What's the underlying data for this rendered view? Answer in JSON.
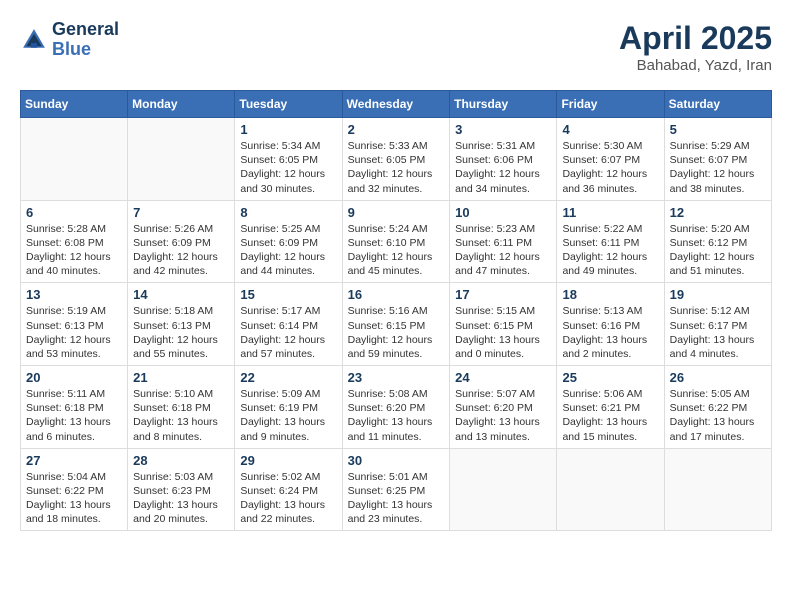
{
  "header": {
    "logo_line1": "General",
    "logo_line2": "Blue",
    "month": "April 2025",
    "location": "Bahabad, Yazd, Iran"
  },
  "weekdays": [
    "Sunday",
    "Monday",
    "Tuesday",
    "Wednesday",
    "Thursday",
    "Friday",
    "Saturday"
  ],
  "weeks": [
    [
      {
        "day": "",
        "info": ""
      },
      {
        "day": "",
        "info": ""
      },
      {
        "day": "1",
        "info": "Sunrise: 5:34 AM\nSunset: 6:05 PM\nDaylight: 12 hours and 30 minutes."
      },
      {
        "day": "2",
        "info": "Sunrise: 5:33 AM\nSunset: 6:05 PM\nDaylight: 12 hours and 32 minutes."
      },
      {
        "day": "3",
        "info": "Sunrise: 5:31 AM\nSunset: 6:06 PM\nDaylight: 12 hours and 34 minutes."
      },
      {
        "day": "4",
        "info": "Sunrise: 5:30 AM\nSunset: 6:07 PM\nDaylight: 12 hours and 36 minutes."
      },
      {
        "day": "5",
        "info": "Sunrise: 5:29 AM\nSunset: 6:07 PM\nDaylight: 12 hours and 38 minutes."
      }
    ],
    [
      {
        "day": "6",
        "info": "Sunrise: 5:28 AM\nSunset: 6:08 PM\nDaylight: 12 hours and 40 minutes."
      },
      {
        "day": "7",
        "info": "Sunrise: 5:26 AM\nSunset: 6:09 PM\nDaylight: 12 hours and 42 minutes."
      },
      {
        "day": "8",
        "info": "Sunrise: 5:25 AM\nSunset: 6:09 PM\nDaylight: 12 hours and 44 minutes."
      },
      {
        "day": "9",
        "info": "Sunrise: 5:24 AM\nSunset: 6:10 PM\nDaylight: 12 hours and 45 minutes."
      },
      {
        "day": "10",
        "info": "Sunrise: 5:23 AM\nSunset: 6:11 PM\nDaylight: 12 hours and 47 minutes."
      },
      {
        "day": "11",
        "info": "Sunrise: 5:22 AM\nSunset: 6:11 PM\nDaylight: 12 hours and 49 minutes."
      },
      {
        "day": "12",
        "info": "Sunrise: 5:20 AM\nSunset: 6:12 PM\nDaylight: 12 hours and 51 minutes."
      }
    ],
    [
      {
        "day": "13",
        "info": "Sunrise: 5:19 AM\nSunset: 6:13 PM\nDaylight: 12 hours and 53 minutes."
      },
      {
        "day": "14",
        "info": "Sunrise: 5:18 AM\nSunset: 6:13 PM\nDaylight: 12 hours and 55 minutes."
      },
      {
        "day": "15",
        "info": "Sunrise: 5:17 AM\nSunset: 6:14 PM\nDaylight: 12 hours and 57 minutes."
      },
      {
        "day": "16",
        "info": "Sunrise: 5:16 AM\nSunset: 6:15 PM\nDaylight: 12 hours and 59 minutes."
      },
      {
        "day": "17",
        "info": "Sunrise: 5:15 AM\nSunset: 6:15 PM\nDaylight: 13 hours and 0 minutes."
      },
      {
        "day": "18",
        "info": "Sunrise: 5:13 AM\nSunset: 6:16 PM\nDaylight: 13 hours and 2 minutes."
      },
      {
        "day": "19",
        "info": "Sunrise: 5:12 AM\nSunset: 6:17 PM\nDaylight: 13 hours and 4 minutes."
      }
    ],
    [
      {
        "day": "20",
        "info": "Sunrise: 5:11 AM\nSunset: 6:18 PM\nDaylight: 13 hours and 6 minutes."
      },
      {
        "day": "21",
        "info": "Sunrise: 5:10 AM\nSunset: 6:18 PM\nDaylight: 13 hours and 8 minutes."
      },
      {
        "day": "22",
        "info": "Sunrise: 5:09 AM\nSunset: 6:19 PM\nDaylight: 13 hours and 9 minutes."
      },
      {
        "day": "23",
        "info": "Sunrise: 5:08 AM\nSunset: 6:20 PM\nDaylight: 13 hours and 11 minutes."
      },
      {
        "day": "24",
        "info": "Sunrise: 5:07 AM\nSunset: 6:20 PM\nDaylight: 13 hours and 13 minutes."
      },
      {
        "day": "25",
        "info": "Sunrise: 5:06 AM\nSunset: 6:21 PM\nDaylight: 13 hours and 15 minutes."
      },
      {
        "day": "26",
        "info": "Sunrise: 5:05 AM\nSunset: 6:22 PM\nDaylight: 13 hours and 17 minutes."
      }
    ],
    [
      {
        "day": "27",
        "info": "Sunrise: 5:04 AM\nSunset: 6:22 PM\nDaylight: 13 hours and 18 minutes."
      },
      {
        "day": "28",
        "info": "Sunrise: 5:03 AM\nSunset: 6:23 PM\nDaylight: 13 hours and 20 minutes."
      },
      {
        "day": "29",
        "info": "Sunrise: 5:02 AM\nSunset: 6:24 PM\nDaylight: 13 hours and 22 minutes."
      },
      {
        "day": "30",
        "info": "Sunrise: 5:01 AM\nSunset: 6:25 PM\nDaylight: 13 hours and 23 minutes."
      },
      {
        "day": "",
        "info": ""
      },
      {
        "day": "",
        "info": ""
      },
      {
        "day": "",
        "info": ""
      }
    ]
  ]
}
